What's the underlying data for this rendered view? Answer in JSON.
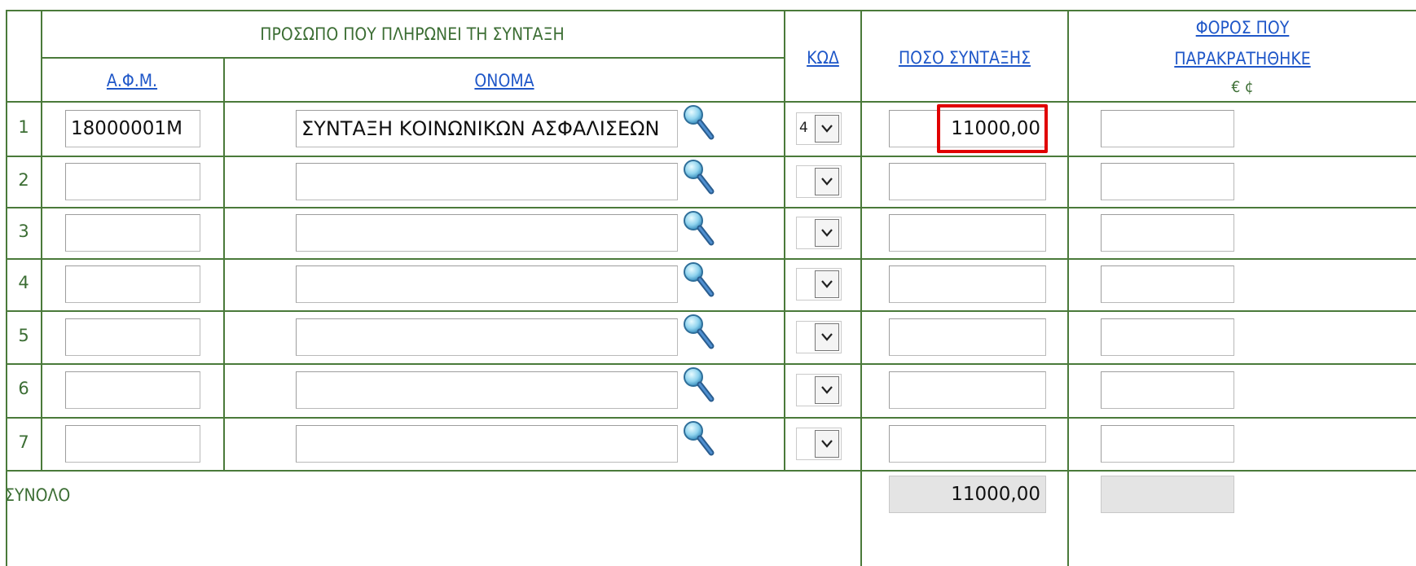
{
  "header": {
    "payer_group": "ΠΡΟΣΩΠΟ ΠΟΥ ΠΛΗΡΩΝΕΙ ΤΗ ΣΥΝΤΑΞΗ",
    "afm": "Α.Φ.Μ.",
    "name": "ΟΝΟΜΑ",
    "code": "ΚΩΔ",
    "amount": "ΠΟΣΟ ΣΥΝΤΑΞΗΣ",
    "tax_line1": "ΦΟΡΟΣ ΠΟΥ",
    "tax_line2": "ΠΑΡΑΚΡΑΤΗΘΗΚΕ",
    "tax_units": "€ ¢"
  },
  "rows": [
    {
      "num": "1",
      "afm": "18000001Μ",
      "name": "ΣΥΝΤΑΞΗ ΚΟΙΝΩΝΙΚΩΝ ΑΣΦΑΛΙΣΕΩΝ",
      "code": "4",
      "amount": "11000,00",
      "tax": ""
    },
    {
      "num": "2",
      "afm": "",
      "name": "",
      "code": "",
      "amount": "",
      "tax": ""
    },
    {
      "num": "3",
      "afm": "",
      "name": "",
      "code": "",
      "amount": "",
      "tax": ""
    },
    {
      "num": "4",
      "afm": "",
      "name": "",
      "code": "",
      "amount": "",
      "tax": ""
    },
    {
      "num": "5",
      "afm": "",
      "name": "",
      "code": "",
      "amount": "",
      "tax": ""
    },
    {
      "num": "6",
      "afm": "",
      "name": "",
      "code": "",
      "amount": "",
      "tax": ""
    },
    {
      "num": "7",
      "afm": "",
      "name": "",
      "code": "",
      "amount": "",
      "tax": ""
    }
  ],
  "total": {
    "label": "ΣΥΝΟΛΟ",
    "amount": "11000,00",
    "tax": ""
  },
  "colors": {
    "grid": "#4a7a3a",
    "label_text": "#3c6e34",
    "link": "#1f57c8",
    "highlight": "#e00000"
  },
  "icons": {
    "lookup": "magnifier-icon",
    "dropdown": "chevron-down-icon"
  }
}
